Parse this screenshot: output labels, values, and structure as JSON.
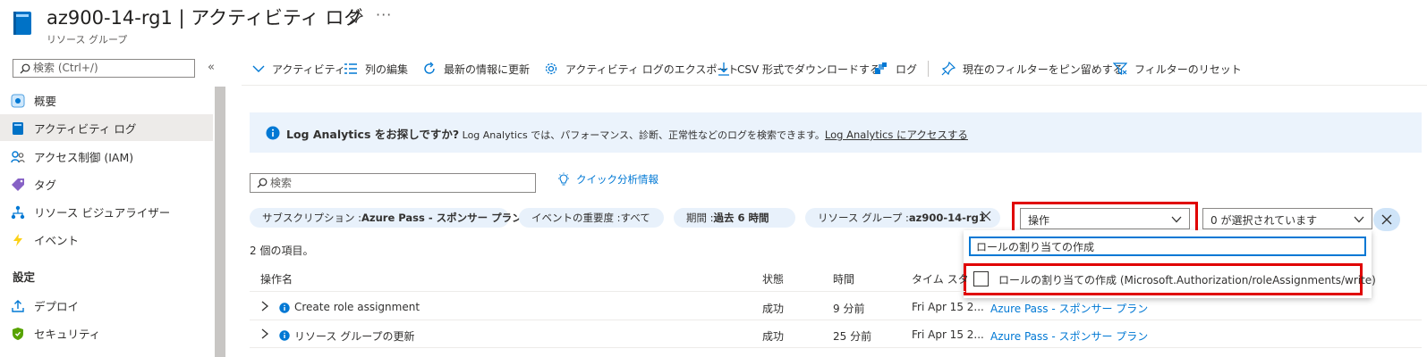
{
  "header": {
    "title": "az900-14-rg1 | アクティビティ ログ",
    "subtitle": "リソース グループ",
    "more": "···"
  },
  "nav": {
    "search_placeholder": "検索 (Ctrl+/)",
    "collapse": "«",
    "items": [
      {
        "label": "概要",
        "icon": "overview-icon"
      },
      {
        "label": "アクティビティ ログ",
        "icon": "activity-log-icon",
        "selected": true
      },
      {
        "label": "アクセス制御 (IAM)",
        "icon": "iam-icon"
      },
      {
        "label": "タグ",
        "icon": "tag-icon"
      },
      {
        "label": "リソース ビジュアライザー",
        "icon": "visualizer-icon"
      },
      {
        "label": "イベント",
        "icon": "event-icon"
      }
    ],
    "section_settings": "設定",
    "settings_items": [
      {
        "label": "デプロイ",
        "icon": "deploy-icon"
      },
      {
        "label": "セキュリティ",
        "icon": "security-icon"
      }
    ]
  },
  "toolbar": {
    "activity": "アクティビティ",
    "edit_columns": "列の編集",
    "refresh": "最新の情報に更新",
    "export": "アクティビティ ログのエクスポート",
    "download_csv": "CSV 形式でダウンロードする",
    "logs": "ログ",
    "pin_filter": "現在のフィルターをピン留めする",
    "reset_filter": "フィルターのリセット"
  },
  "banner": {
    "strong": "Log Analytics をお探しですか?",
    "text": " Log Analytics では、パフォーマンス、診断、正常性などのログを検索できます。",
    "link": "Log Analytics にアクセスする"
  },
  "search": {
    "placeholder": "検索"
  },
  "quick_insights": "クイック分析情報",
  "filters": {
    "subscription_label": "サブスクリプション : ",
    "subscription_value": "Azure Pass - スポンサー プラン",
    "severity_label": "イベントの重要度 : ",
    "severity_value": "すべて",
    "timespan_label": "期間 : ",
    "timespan_value": "過去 6 時間",
    "rg_label": "リソース グループ : ",
    "rg_value": "az900-14-rg1",
    "operation_dropdown": "操作",
    "selection_dropdown": "0 が選択されています"
  },
  "dropdown": {
    "filter_value": "ロールの割り当ての作成",
    "option_label": "ロールの割り当ての作成 (Microsoft.Authorization/roleAssignments/write)"
  },
  "count_text": "2 個の項目。",
  "table": {
    "columns": [
      "操作名",
      "状態",
      "時間",
      "タイム スタ"
    ],
    "rows": [
      {
        "name": "Create role assignment",
        "status": "成功",
        "time": "9 分前",
        "timestamp": "Fri Apr 15 2...",
        "subscription": "Azure Pass - スポンサー プラン"
      },
      {
        "name": "リソース グループの更新",
        "status": "成功",
        "time": "25 分前",
        "timestamp": "Fri Apr 15 2...",
        "subscription": "Azure Pass - スポンサー プラン"
      }
    ]
  },
  "colors": {
    "accent": "#0078d4",
    "highlight": "#e00000",
    "banner_bg": "#ebf3fc",
    "pill_bg": "#e8f1fb"
  }
}
